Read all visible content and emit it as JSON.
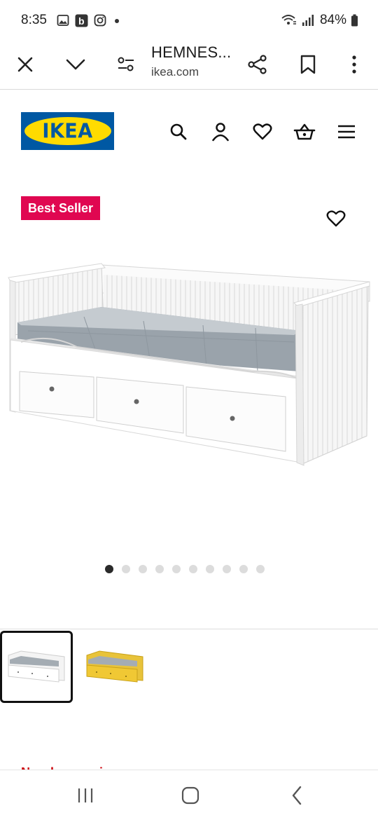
{
  "status_bar": {
    "time": "8:35",
    "battery": "84%",
    "icons": [
      "gallery-icon",
      "booking-b-icon",
      "instagram-icon",
      "dot-icon",
      "wifi-calling-icon",
      "signal-icon",
      "battery-icon"
    ]
  },
  "browser": {
    "title": "HEMNES...",
    "url": "ikea.com",
    "icons": [
      "close-icon",
      "chevron-down-icon",
      "page-settings-icon",
      "share-icon",
      "bookmark-icon",
      "more-vert-icon"
    ]
  },
  "site_header": {
    "logo_text": "IKEA",
    "brand_colors": {
      "blue": "#0058a3",
      "yellow": "#ffdb00"
    },
    "icons": [
      "search-icon",
      "account-icon",
      "wishlist-heart-icon",
      "basket-icon",
      "menu-hamburger-icon"
    ]
  },
  "product": {
    "badge": "Best Seller",
    "badge_color": "#e00751",
    "image_alt": "White daybed with three drawers and grey mattress",
    "gallery": {
      "count": 10,
      "active_index": 0
    },
    "thumbnails": [
      {
        "variant": "white",
        "selected": true
      },
      {
        "variant": "yellow",
        "selected": false
      }
    ],
    "partial_text": "New lower price"
  },
  "nav_bar": {
    "icons": [
      "recent-apps-icon",
      "home-icon",
      "back-icon"
    ]
  }
}
